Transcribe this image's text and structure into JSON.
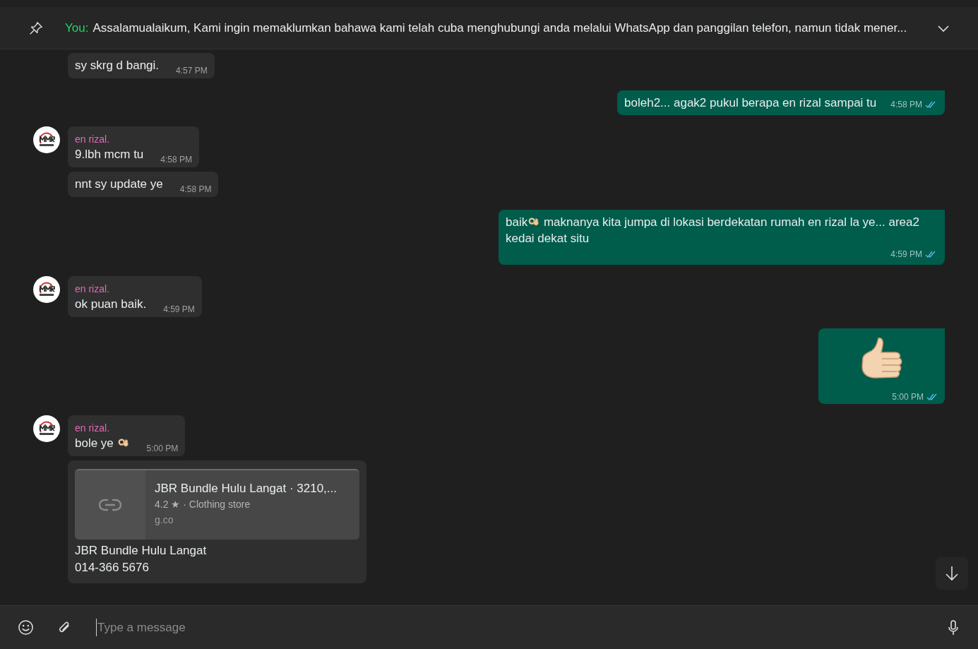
{
  "pinned": {
    "sender": "You:",
    "text": "Assalamualaikum,  Kami ingin memaklumkan bahawa kami telah cuba menghubungi anda melalui WhatsApp dan panggilan telefon, namun tidak mener..."
  },
  "messages": [
    {
      "kind": "incoming",
      "first": false,
      "parts": [
        "sy skrg d bangi."
      ],
      "time": "4:57 PM"
    },
    {
      "kind": "outgoing",
      "parts": [
        "boleh2... agak2 pukul berapa en rizal sampai tu"
      ],
      "time": "4:58 PM",
      "read": true
    },
    {
      "kind": "incoming",
      "first": true,
      "sender": "en rizal.",
      "parts": [
        "9.lbh mcm tu"
      ],
      "time": "4:58 PM"
    },
    {
      "kind": "incoming",
      "first": false,
      "parts": [
        "nnt sy update ye"
      ],
      "time": "4:58 PM"
    },
    {
      "kind": "outgoing-emoji",
      "parts": [
        "baik",
        " maknanya kita jumpa di lokasi berdekatan rumah en rizal la ye... area2 kedai dekat situ"
      ],
      "time": "4:59 PM",
      "read": true
    },
    {
      "kind": "incoming",
      "first": true,
      "sender": "en rizal.",
      "parts": [
        "ok puan baik."
      ],
      "time": "4:59 PM"
    },
    {
      "kind": "outgoing-sticker",
      "time": "5:00 PM",
      "read": true
    },
    {
      "kind": "incoming-emoji",
      "first": true,
      "sender": "en rizal.",
      "parts": [
        "bole ye "
      ],
      "time": "5:00 PM"
    },
    {
      "kind": "incoming-link",
      "preview": {
        "title": "JBR Bundle Hulu Langat · 3210,...",
        "subtitle": "4.2 ★ · Clothing store",
        "domain": "g.co"
      },
      "lines": [
        "JBR Bundle Hulu Langat",
        "014-366 5676"
      ]
    }
  ],
  "composer": {
    "placeholder": "Type a message"
  }
}
